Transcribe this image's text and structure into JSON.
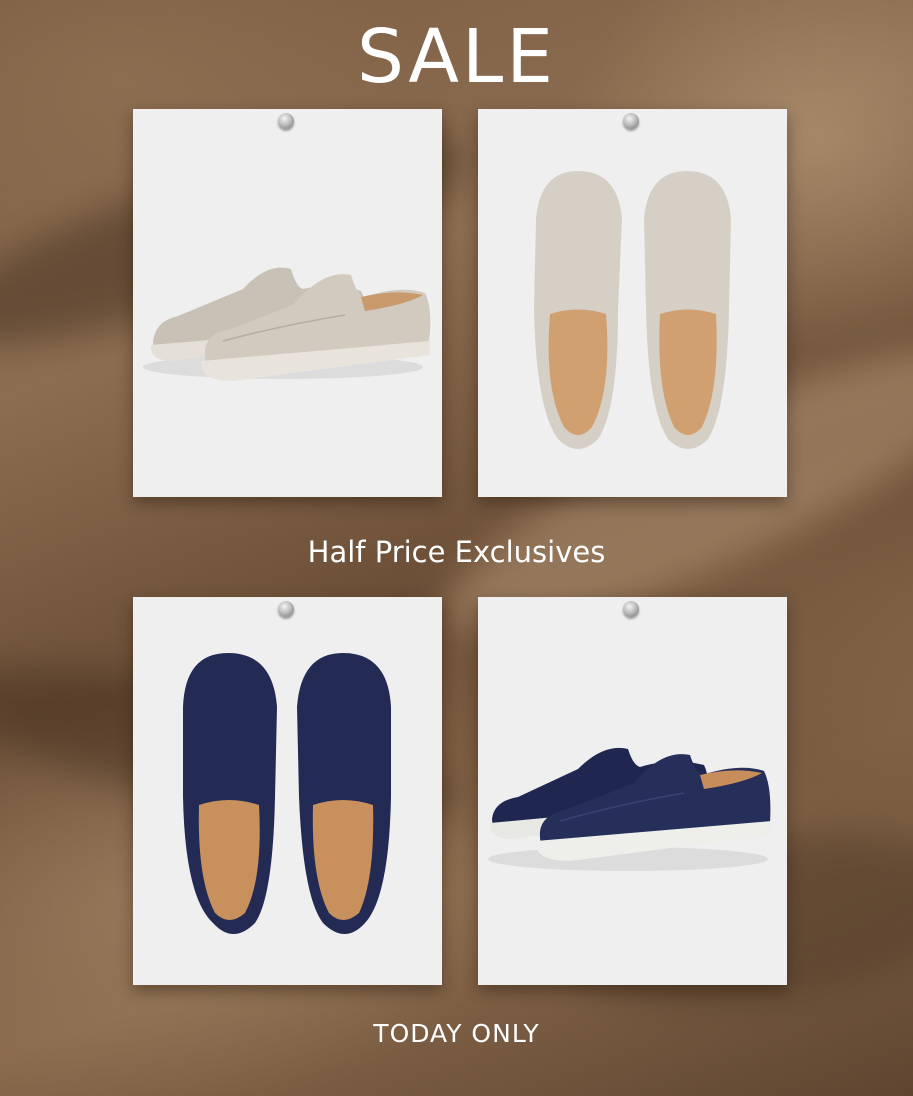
{
  "banner": {
    "title": "SALE",
    "subtitle": "Half Price Exclusives",
    "footer": "TODAY ONLY"
  },
  "products": [
    {
      "colorway": "stone suede loafer",
      "view": "side-pair",
      "upper": "#cfc7bc",
      "sole": "#e7e2da",
      "lining": "#c99a6a"
    },
    {
      "colorway": "stone suede loafer",
      "view": "top-pair",
      "upper": "#d8d2c9",
      "sole": "#e7e2da",
      "lining": "#d2a272"
    },
    {
      "colorway": "navy suede loafer",
      "view": "top-pair",
      "upper": "#242c55",
      "sole": "#1d2447",
      "lining": "#c98f5a"
    },
    {
      "colorway": "navy suede loafer",
      "view": "side-pair",
      "upper": "#252d58",
      "sole": "#eeeeea",
      "lining": "#c78e5c"
    }
  ],
  "colors": {
    "text": "#ffffff",
    "card": "#efefef"
  }
}
